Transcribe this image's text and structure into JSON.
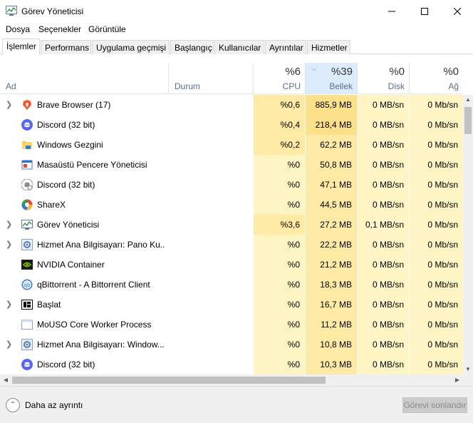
{
  "window": {
    "title": "Görev Yöneticisi"
  },
  "menu": [
    "Dosya",
    "Seçenekler",
    "Görüntüle"
  ],
  "tabs": [
    "İşlemler",
    "Performans",
    "Uygulama geçmişi",
    "Başlangıç",
    "Kullanıcılar",
    "Ayrıntılar",
    "Hizmetler"
  ],
  "columns": {
    "name": {
      "label": "Ad"
    },
    "status": {
      "label": "Durum"
    },
    "cpu": {
      "pct": "%6",
      "label": "CPU"
    },
    "memory": {
      "pct": "%39",
      "label": "Bellek"
    },
    "disk": {
      "pct": "%0",
      "label": "Disk"
    },
    "network": {
      "pct": "%0",
      "label": "Ağ"
    }
  },
  "processes": [
    {
      "name": "Brave Browser (17)",
      "icon": "brave-icon",
      "expandable": true,
      "cpu": "%0,6",
      "memory": "885,9 MB",
      "disk": "0 MB/sn",
      "network": "0 Mb/sn"
    },
    {
      "name": "Discord (32 bit)",
      "icon": "discord-icon",
      "expandable": false,
      "cpu": "%0,4",
      "memory": "218,4 MB",
      "disk": "0 MB/sn",
      "network": "0 Mb/sn"
    },
    {
      "name": "Windows Gezgini",
      "icon": "folder-icon",
      "expandable": false,
      "cpu": "%0,2",
      "memory": "62,2 MB",
      "disk": "0 MB/sn",
      "network": "0 Mb/sn"
    },
    {
      "name": "Masaüstü Pencere Yöneticisi",
      "icon": "window-manager-icon",
      "expandable": false,
      "cpu": "%0",
      "memory": "50,8 MB",
      "disk": "0 MB/sn",
      "network": "0 Mb/sn"
    },
    {
      "name": "Discord (32 bit)",
      "icon": "discord-gray-icon",
      "expandable": false,
      "cpu": "%0",
      "memory": "47,1 MB",
      "disk": "0 MB/sn",
      "network": "0 Mb/sn"
    },
    {
      "name": "ShareX",
      "icon": "sharex-icon",
      "expandable": false,
      "cpu": "%0",
      "memory": "44,5 MB",
      "disk": "0 MB/sn",
      "network": "0 Mb/sn"
    },
    {
      "name": "Görev Yöneticisi",
      "icon": "task-manager-icon",
      "expandable": true,
      "cpu": "%3,6",
      "memory": "27,2 MB",
      "disk": "0,1 MB/sn",
      "network": "0 Mb/sn"
    },
    {
      "name": "Hizmet Ana Bilgisayarı: Pano Ku...",
      "icon": "service-host-icon",
      "expandable": true,
      "cpu": "%0",
      "memory": "22,2 MB",
      "disk": "0 MB/sn",
      "network": "0 Mb/sn"
    },
    {
      "name": "NVIDIA Container",
      "icon": "nvidia-icon",
      "expandable": false,
      "cpu": "%0",
      "memory": "21,2 MB",
      "disk": "0 MB/sn",
      "network": "0 Mb/sn"
    },
    {
      "name": "qBittorrent - A Bittorrent Client",
      "icon": "qbittorrent-icon",
      "expandable": false,
      "cpu": "%0",
      "memory": "18,3 MB",
      "disk": "0 MB/sn",
      "network": "0 Mb/sn"
    },
    {
      "name": "Başlat",
      "icon": "start-icon",
      "expandable": true,
      "cpu": "%0",
      "memory": "16,7 MB",
      "disk": "0 MB/sn",
      "network": "0 Mb/sn"
    },
    {
      "name": "MoUSO Core Worker Process",
      "icon": "generic-app-icon",
      "expandable": false,
      "cpu": "%0",
      "memory": "11,2 MB",
      "disk": "0 MB/sn",
      "network": "0 Mb/sn"
    },
    {
      "name": "Hizmet Ana Bilgisayarı: Window...",
      "icon": "service-host-icon",
      "expandable": true,
      "cpu": "%0",
      "memory": "10,8 MB",
      "disk": "0 MB/sn",
      "network": "0 Mb/sn"
    },
    {
      "name": "Discord (32 bit)",
      "icon": "discord-icon",
      "expandable": false,
      "cpu": "%0",
      "memory": "10,3 MB",
      "disk": "0 MB/sn",
      "network": "0 Mb/sn"
    }
  ],
  "footer": {
    "fewer_details": "Daha az ayrıntı",
    "end_task": "Görevi sonlandır"
  },
  "colors": {
    "sort_header": "#dcecfc",
    "heat_light": "#fff4c4",
    "heat_mid": "#ffeaa5",
    "heat_strong": "#fde08a",
    "brave": "#fb542b",
    "discord": "#5865f2",
    "nvidia": "#76b900",
    "qbittorrent": "#3c7fc1"
  }
}
